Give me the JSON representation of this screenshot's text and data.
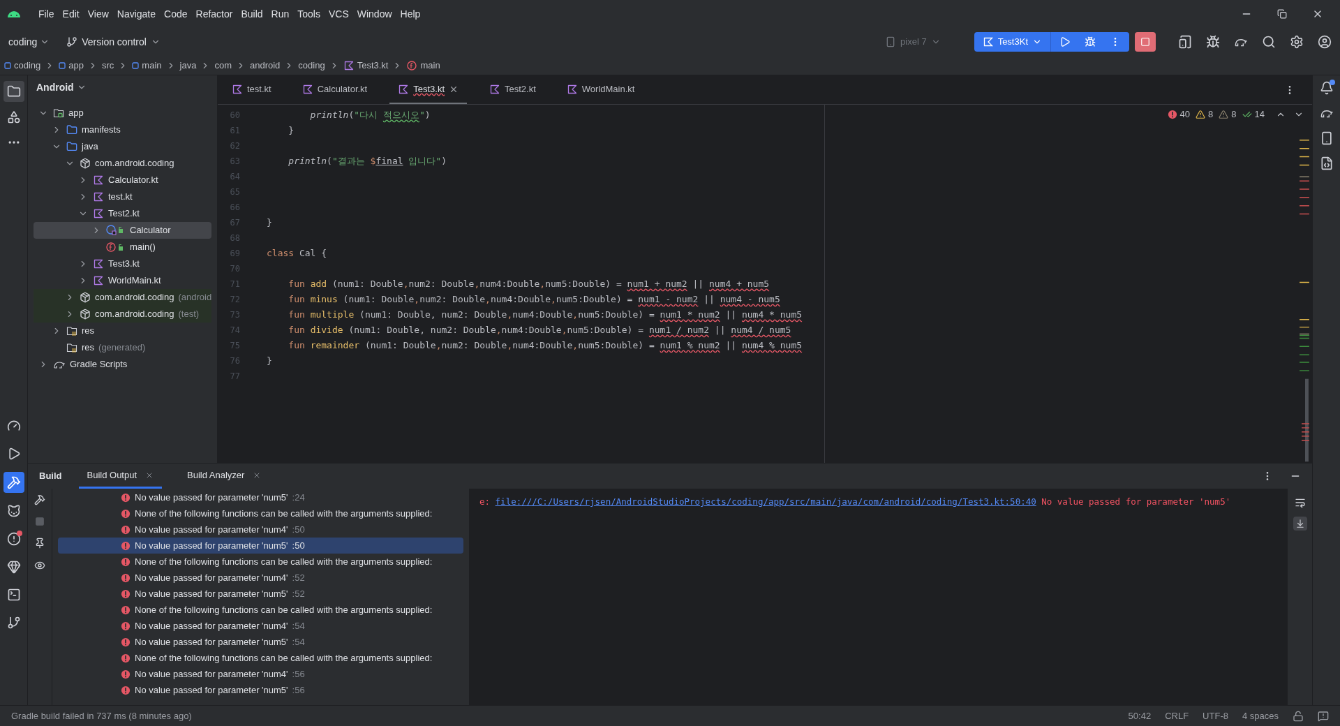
{
  "menu": [
    "File",
    "Edit",
    "View",
    "Navigate",
    "Code",
    "Refactor",
    "Build",
    "Run",
    "Tools",
    "VCS",
    "Window",
    "Help"
  ],
  "toolbar": {
    "project": "coding",
    "vcs": "Version control",
    "device": "pixel 7",
    "device_disabled": true,
    "run_config": "Test3Kt"
  },
  "breadcrumbs": [
    {
      "label": "coding",
      "kind": "module"
    },
    {
      "label": "app",
      "kind": "module"
    },
    {
      "label": "src",
      "kind": "plain"
    },
    {
      "label": "main",
      "kind": "module"
    },
    {
      "label": "java",
      "kind": "plain"
    },
    {
      "label": "com",
      "kind": "plain"
    },
    {
      "label": "android",
      "kind": "plain"
    },
    {
      "label": "coding",
      "kind": "plain"
    },
    {
      "label": "Test3.kt",
      "kind": "kotlin"
    },
    {
      "label": "main",
      "kind": "function"
    }
  ],
  "project_panel": {
    "view": "Android",
    "tree": [
      {
        "label": "app",
        "kind": "module",
        "expanded": true,
        "selected": false,
        "children": [
          {
            "label": "manifests",
            "kind": "folder",
            "expanded": false,
            "selected": false
          },
          {
            "label": "java",
            "kind": "folder",
            "expanded": true,
            "selected": false,
            "children": [
              {
                "label": "com.android.coding",
                "kind": "package",
                "tinted": false,
                "expanded": true,
                "selected": false,
                "children": [
                  {
                    "label": "Calculator.kt",
                    "kind": "kotlin",
                    "expanded": false,
                    "selected": false
                  },
                  {
                    "label": "test.kt",
                    "kind": "kotlin",
                    "expanded": false,
                    "selected": false
                  },
                  {
                    "label": "Test2.kt",
                    "kind": "kotlin",
                    "expanded": true,
                    "selected": false,
                    "children": [
                      {
                        "label": "Calculator",
                        "kind": "class",
                        "expanded": false,
                        "selected": true
                      },
                      {
                        "label": "main()",
                        "kind": "function",
                        "selected": false
                      }
                    ]
                  },
                  {
                    "label": "Test3.kt",
                    "kind": "kotlin",
                    "expanded": false,
                    "selected": false
                  },
                  {
                    "label": "WorldMain.kt",
                    "kind": "kotlin",
                    "expanded": false,
                    "selected": false
                  }
                ]
              },
              {
                "label": "com.android.coding",
                "suffix": "(android",
                "kind": "package",
                "tinted": true,
                "expanded": false,
                "selected": false
              },
              {
                "label": "com.android.coding",
                "suffix": "(test)",
                "kind": "package",
                "tinted": true,
                "expanded": false,
                "selected": false
              }
            ]
          },
          {
            "label": "res",
            "kind": "res",
            "expanded": false,
            "selected": false
          },
          {
            "label": "res",
            "suffix": "(generated)",
            "kind": "res",
            "selected": false
          }
        ]
      },
      {
        "label": "Gradle Scripts",
        "kind": "gradle",
        "expanded": false,
        "selected": false
      }
    ]
  },
  "editor": {
    "tabs": [
      {
        "label": "test.kt",
        "selected": false
      },
      {
        "label": "Calculator.kt",
        "selected": false
      },
      {
        "label": "Test3.kt",
        "selected": true
      },
      {
        "label": "Test2.kt",
        "selected": false
      },
      {
        "label": "WorldMain.kt",
        "selected": false
      }
    ],
    "inspections": {
      "errors": "40",
      "warnings": "8",
      "weak_warnings": "8",
      "typos": "14"
    },
    "lines": [
      {
        "number": "60",
        "segments": [
          {
            "text": "        println",
            "kind": "call"
          },
          {
            "text": "(",
            "kind": "plain"
          },
          {
            "text": "\"다시 ",
            "kind": "string"
          },
          {
            "text": "적으시오",
            "kind": "string_typo"
          },
          {
            "text": "\"",
            "kind": "string"
          },
          {
            "text": ")",
            "kind": "plain"
          }
        ]
      },
      {
        "number": "61",
        "segments": [
          {
            "text": "    }",
            "kind": "plain"
          }
        ]
      },
      {
        "number": "62"
      },
      {
        "number": "63",
        "segments": [
          {
            "text": "    println",
            "kind": "call"
          },
          {
            "text": "(",
            "kind": "plain"
          },
          {
            "text": "\"결과는 ",
            "kind": "string"
          },
          {
            "text": "$",
            "kind": "template"
          },
          {
            "text": "final",
            "kind": "var_ref"
          },
          {
            "text": " 입니다\"",
            "kind": "string"
          },
          {
            "text": ")",
            "kind": "plain"
          }
        ]
      },
      {
        "number": "64"
      },
      {
        "number": "65"
      },
      {
        "number": "66"
      },
      {
        "number": "67",
        "segments": [
          {
            "text": "}",
            "kind": "plain"
          }
        ]
      },
      {
        "number": "68"
      },
      {
        "number": "69",
        "segments": [
          {
            "text": "class",
            "kind": "keyword"
          },
          {
            "text": " Cal {",
            "kind": "plain"
          }
        ]
      },
      {
        "number": "70"
      },
      {
        "number": "71",
        "segments": [
          {
            "text": "    fun ",
            "kind": "keyword"
          },
          {
            "text": "add",
            "kind": "decl"
          },
          {
            "text": " (num1: Double",
            "kind": "plain"
          },
          {
            "text": ",",
            "kind": "punct"
          },
          {
            "text": "num2: Double",
            "kind": "plain"
          },
          {
            "text": ",",
            "kind": "punct"
          },
          {
            "text": "num4:Double",
            "kind": "plain"
          },
          {
            "text": ",",
            "kind": "punct"
          },
          {
            "text": "num5:Double) = ",
            "kind": "plain"
          },
          {
            "text": "num1 + num2",
            "kind": "error"
          },
          {
            "text": " || ",
            "kind": "plain"
          },
          {
            "text": "num4 + num5",
            "kind": "error"
          }
        ]
      },
      {
        "number": "72",
        "segments": [
          {
            "text": "    fun ",
            "kind": "keyword"
          },
          {
            "text": "minus",
            "kind": "decl"
          },
          {
            "text": " (num1: Double",
            "kind": "plain"
          },
          {
            "text": ",",
            "kind": "punct"
          },
          {
            "text": "num2: Double",
            "kind": "plain"
          },
          {
            "text": ",",
            "kind": "punct"
          },
          {
            "text": "num4:Double",
            "kind": "plain"
          },
          {
            "text": ",",
            "kind": "punct"
          },
          {
            "text": "num5:Double) = ",
            "kind": "plain"
          },
          {
            "text": "num1 - num2",
            "kind": "error"
          },
          {
            "text": " || ",
            "kind": "plain"
          },
          {
            "text": "num4 - num5",
            "kind": "error"
          }
        ]
      },
      {
        "number": "73",
        "segments": [
          {
            "text": "    fun ",
            "kind": "keyword"
          },
          {
            "text": "multiple",
            "kind": "decl"
          },
          {
            "text": " (num1: Double, num2: Double",
            "kind": "plain"
          },
          {
            "text": ",",
            "kind": "punct"
          },
          {
            "text": "num4:Double",
            "kind": "plain"
          },
          {
            "text": ",",
            "kind": "punct"
          },
          {
            "text": "num5:Double) = ",
            "kind": "plain"
          },
          {
            "text": "num1 * num2",
            "kind": "error"
          },
          {
            "text": " || ",
            "kind": "plain"
          },
          {
            "text": "num4 * num5",
            "kind": "error"
          }
        ]
      },
      {
        "number": "74",
        "segments": [
          {
            "text": "    fun ",
            "kind": "keyword"
          },
          {
            "text": "divide",
            "kind": "decl"
          },
          {
            "text": " (num1: Double, num2: Double",
            "kind": "plain"
          },
          {
            "text": ",",
            "kind": "punct"
          },
          {
            "text": "num4:Double",
            "kind": "plain"
          },
          {
            "text": ",",
            "kind": "punct"
          },
          {
            "text": "num5:Double) = ",
            "kind": "plain"
          },
          {
            "text": "num1 / num2",
            "kind": "error"
          },
          {
            "text": " || ",
            "kind": "plain"
          },
          {
            "text": "num4 / num5",
            "kind": "error"
          }
        ]
      },
      {
        "number": "75",
        "segments": [
          {
            "text": "    fun ",
            "kind": "keyword"
          },
          {
            "text": "remainder",
            "kind": "decl"
          },
          {
            "text": " (num1: Double",
            "kind": "plain"
          },
          {
            "text": ",",
            "kind": "punct"
          },
          {
            "text": "num2: Double",
            "kind": "plain"
          },
          {
            "text": ",",
            "kind": "punct"
          },
          {
            "text": "num4:Double",
            "kind": "plain"
          },
          {
            "text": ",",
            "kind": "punct"
          },
          {
            "text": "num5:Double) = ",
            "kind": "plain"
          },
          {
            "text": "num1 % num2",
            "kind": "error"
          },
          {
            "text": " || ",
            "kind": "plain"
          },
          {
            "text": "num4 % num5",
            "kind": "error"
          }
        ]
      },
      {
        "number": "76",
        "segments": [
          {
            "text": "}",
            "kind": "plain"
          }
        ]
      },
      {
        "number": "77"
      }
    ]
  },
  "build_panel": {
    "title": "Build",
    "tabs": [
      {
        "label": "Build Output",
        "selected": true
      },
      {
        "label": "Build Analyzer",
        "selected": false
      }
    ],
    "messages": [
      {
        "text": "No value passed for parameter 'num5'",
        "line": ":24",
        "selected": false
      },
      {
        "text": "None of the following functions can be called with the arguments supplied:",
        "selected": false
      },
      {
        "text": "No value passed for parameter 'num4'",
        "line": ":50",
        "selected": false
      },
      {
        "text": "No value passed for parameter 'num5'",
        "line": ":50",
        "selected": true
      },
      {
        "text": "None of the following functions can be called with the arguments supplied:",
        "selected": false
      },
      {
        "text": "No value passed for parameter 'num4'",
        "line": ":52",
        "selected": false
      },
      {
        "text": "No value passed for parameter 'num5'",
        "line": ":52",
        "selected": false
      },
      {
        "text": "None of the following functions can be called with the arguments supplied:",
        "selected": false
      },
      {
        "text": "No value passed for parameter 'num4'",
        "line": ":54",
        "selected": false
      },
      {
        "text": "No value passed for parameter 'num5'",
        "line": ":54",
        "selected": false
      },
      {
        "text": "None of the following functions can be called with the arguments supplied:",
        "selected": false
      },
      {
        "text": "No value passed for parameter 'num4'",
        "line": ":56",
        "selected": false
      },
      {
        "text": "No value passed for parameter 'num5'",
        "line": ":56",
        "selected": false
      }
    ],
    "console": {
      "prefix": "e:",
      "link": "file:///C:/Users/rjsen/AndroidStudioProjects/coding/app/src/main/java/com/android/coding/Test3.kt:50:40",
      "message": "No value passed for parameter 'num5'"
    }
  },
  "status_bar": {
    "message": "Gradle build failed in 737 ms (8 minutes ago)",
    "position": "50:42",
    "line_ending": "CRLF",
    "encoding": "UTF-8",
    "indent": "4 spaces"
  }
}
